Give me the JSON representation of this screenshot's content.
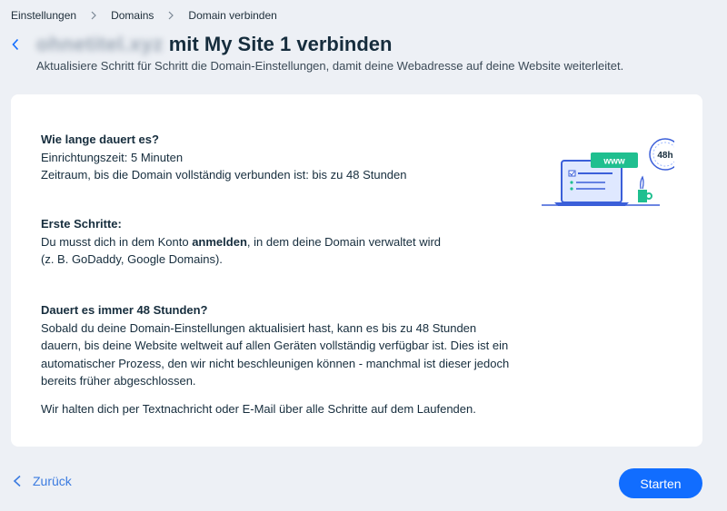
{
  "breadcrumb": {
    "items": [
      "Einstellungen",
      "Domains",
      "Domain verbinden"
    ]
  },
  "header": {
    "domain": "ohnetitel.xyz",
    "title": "mit My Site 1 verbinden",
    "subtitle": "Aktualisiere Schritt für Schritt die Domain-Einstellungen, damit deine Webadresse auf deine Website weiterleitet."
  },
  "card": {
    "duration": {
      "heading": "Wie lange dauert es?",
      "lines": [
        "Einrichtungszeit: 5 Minuten",
        "Zeitraum, bis die Domain vollständig verbunden ist: bis zu 48 Stunden"
      ]
    },
    "first_steps": {
      "heading": "Erste Schritte:",
      "text_before": "Du musst dich in dem Konto ",
      "text_bold": "anmelden",
      "text_after": ", in dem deine Domain verwaltet wird",
      "line2": "(z. B. GoDaddy, Google Domains)."
    },
    "always48": {
      "heading": "Dauert es immer 48 Stunden?",
      "lines": [
        "Sobald du deine Domain-Einstellungen aktualisiert hast, kann es bis zu 48 Stunden",
        "dauern, bis deine Website weltweit auf allen Geräten vollständig verfügbar ist. Dies ist ein",
        "automatischer Prozess, den wir nicht beschleunigen können - manchmal ist dieser jedoch",
        "bereits früher abgeschlossen."
      ]
    },
    "notice": "Wir halten dich per Textnachricht oder E-Mail über alle Schritte auf dem Laufenden.",
    "illustration": {
      "www_label": "www",
      "clock_label": "48h"
    }
  },
  "footer": {
    "back_label": "Zurück",
    "start_label": "Starten"
  },
  "colors": {
    "accent": "#116dff",
    "link": "#3b7be0",
    "background": "#edf0f5",
    "text": "#162d3d"
  },
  "icons": [
    "chevron-right-icon",
    "chevron-left-icon",
    "laptop-www-clock-illustration"
  ]
}
